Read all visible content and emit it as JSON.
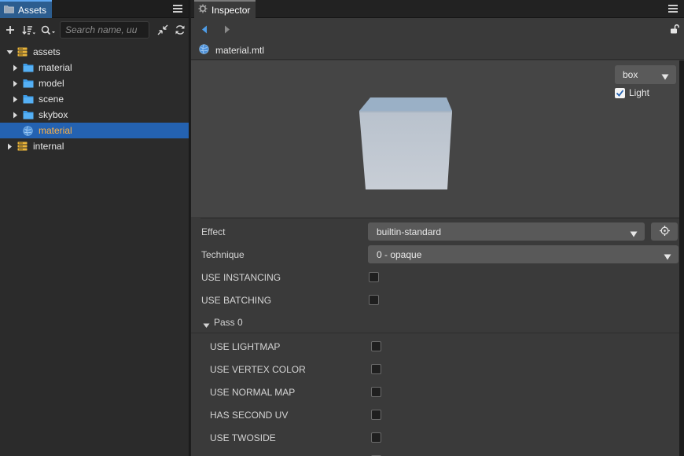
{
  "assets": {
    "tab_label": "Assets",
    "search_placeholder": "Search name, uu",
    "tree": [
      {
        "label": "assets",
        "icon": "db-icon",
        "expanded": true,
        "depth": 0
      },
      {
        "label": "material",
        "icon": "folder-icon",
        "expanded": false,
        "depth": 1
      },
      {
        "label": "model",
        "icon": "folder-icon",
        "expanded": false,
        "depth": 1
      },
      {
        "label": "scene",
        "icon": "folder-icon",
        "expanded": false,
        "depth": 1
      },
      {
        "label": "skybox",
        "icon": "folder-icon",
        "expanded": false,
        "depth": 1
      },
      {
        "label": "material",
        "icon": "material-icon",
        "selected": true,
        "depth": 1
      },
      {
        "label": "internal",
        "icon": "db-icon",
        "expanded": false,
        "depth": 0
      }
    ]
  },
  "inspector": {
    "tab_label": "Inspector",
    "file_name": "material.mtl",
    "preview": {
      "shape_select": "box",
      "light_label": "Light",
      "light_checked": true
    },
    "effect": {
      "label": "Effect",
      "value": "builtin-standard"
    },
    "technique": {
      "label": "Technique",
      "value": "0 - opaque"
    },
    "use_instancing": {
      "label": "USE INSTANCING",
      "checked": false
    },
    "use_batching": {
      "label": "USE BATCHING",
      "checked": false
    },
    "pass": {
      "label": "Pass 0",
      "options": [
        {
          "label": "USE LIGHTMAP",
          "checked": false
        },
        {
          "label": "USE VERTEX COLOR",
          "checked": false
        },
        {
          "label": "USE NORMAL MAP",
          "checked": false
        },
        {
          "label": "HAS SECOND UV",
          "checked": false
        },
        {
          "label": "USE TWOSIDE",
          "checked": false
        }
      ]
    }
  },
  "colors": {
    "accent_blue": "#2462b1",
    "selected_text": "#ffb347",
    "folder_blue": "#3d9ce8",
    "db_yellow": "#e9b43b"
  }
}
